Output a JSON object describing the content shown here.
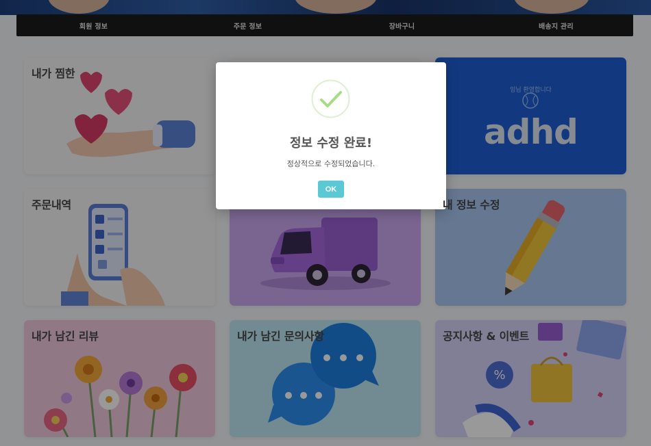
{
  "nav": {
    "items": [
      {
        "label": "회원 정보"
      },
      {
        "label": "주문 정보"
      },
      {
        "label": "장바구니"
      },
      {
        "label": "배송지 관리"
      }
    ]
  },
  "cards": [
    {
      "title": "내가 찜한",
      "icon": "hand-hearts-icon",
      "bg": "#f6f6f6"
    },
    {
      "title": "",
      "icon": "hidden-card",
      "bg": "#f1f1f1"
    },
    {
      "title": "",
      "icon": "adhd-banner",
      "bg": "#1f5fd6",
      "banner_small": "잉님 환영합니다",
      "banner_big": "adhd"
    },
    {
      "title": "주문내역",
      "icon": "phone-checklist-icon",
      "bg": "#f5f5f5"
    },
    {
      "title": "",
      "icon": "delivery-truck-icon",
      "bg": "#caa8f0"
    },
    {
      "title": "내 정보 수정",
      "icon": "pencil-icon",
      "bg": "#a9c6f2"
    },
    {
      "title": "내가 남긴 리뷰",
      "icon": "flowers-icon",
      "bg": "#f2c8de"
    },
    {
      "title": "내가 남긴 문의사항",
      "icon": "chat-bubbles-icon",
      "bg": "#bfe8f3"
    },
    {
      "title": "공지사항 & 이벤트",
      "icon": "shopping-icon",
      "bg": "#d6d4fb"
    }
  ],
  "modal": {
    "icon": "check-icon",
    "title": "정보 수정 완료!",
    "message": "정상적으로 수정되었습니다.",
    "ok_label": "OK",
    "accent": "#5bc8d6",
    "check_color": "#a5dc86"
  }
}
